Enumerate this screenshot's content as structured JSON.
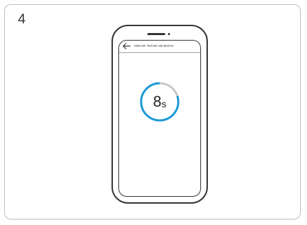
{
  "step": {
    "number": "4"
  },
  "app_screen": {
    "title": "eWeLink- Remote sub-devices",
    "back_icon": "arrow-left-icon"
  },
  "countdown": {
    "value": "8",
    "unit": "s",
    "progress_fraction": 0.8,
    "colors": {
      "progress": "#1a9ad6",
      "track": "#c7c7c7"
    }
  }
}
